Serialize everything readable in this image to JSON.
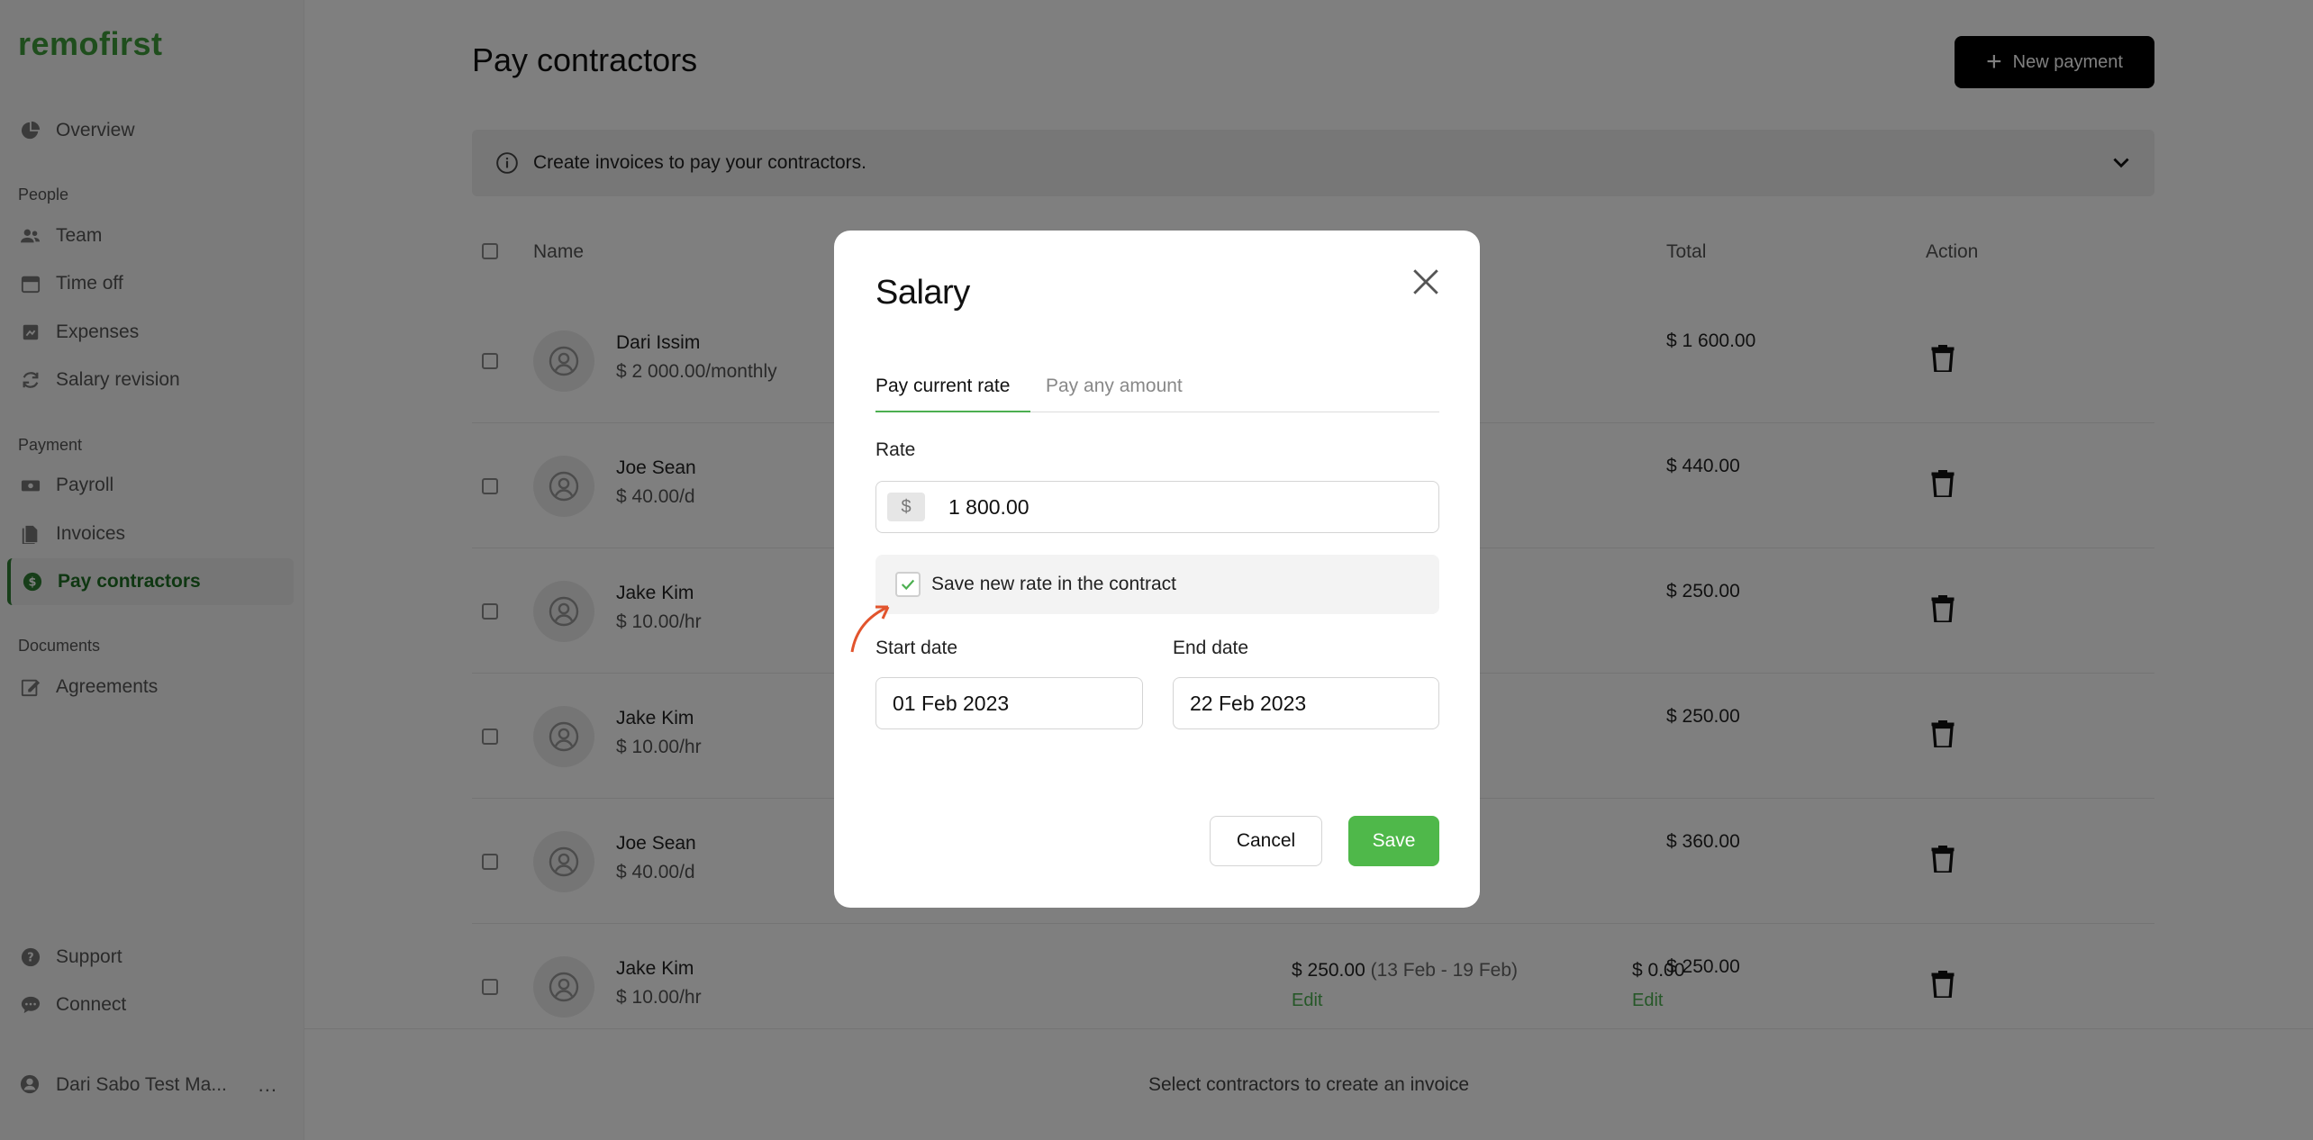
{
  "brand": {
    "logo": "remofirst",
    "accent": "#3e9c3a"
  },
  "sidebar": {
    "overview": "Overview",
    "sections": {
      "people": "People",
      "payment": "Payment",
      "documents": "Documents"
    },
    "people_items": [
      "Team",
      "Time off",
      "Expenses",
      "Salary revision"
    ],
    "payment_items": [
      "Payroll",
      "Invoices",
      "Pay contractors"
    ],
    "documents_items": [
      "Agreements"
    ],
    "bottom_items": [
      "Support",
      "Connect"
    ],
    "active_item": "Pay contractors",
    "user": {
      "name": "Dari Sabo Test Ma...",
      "more": "..."
    }
  },
  "header": {
    "title": "Pay contractors",
    "new_payment_label": "New payment"
  },
  "info": {
    "text": "Create invoices to pay your contractors."
  },
  "table": {
    "headers": {
      "name": "Name",
      "total": "Total",
      "action": "Action"
    },
    "rows": [
      {
        "name": "Dari Issim",
        "rate": "$ 2 000.00/monthly",
        "total": "$ 1 600.00"
      },
      {
        "name": "Joe Sean",
        "rate": "$ 40.00/d",
        "total": "$ 440.00"
      },
      {
        "name": "Jake Kim",
        "rate": "$ 10.00/hr",
        "total": "$ 250.00"
      },
      {
        "name": "Jake Kim",
        "rate": "$ 10.00/hr",
        "total": "$ 250.00"
      },
      {
        "name": "Joe Sean",
        "rate": "$ 40.00/d",
        "total": "$ 360.00"
      },
      {
        "name": "Jake Kim",
        "rate": "$ 10.00/hr",
        "total": "$ 250.00",
        "amount": "$ 250.00",
        "period": "(13 Feb - 19 Feb)",
        "extra": "$ 0.00",
        "edit": "Edit"
      }
    ]
  },
  "footer": {
    "text": "Select contractors to create an invoice"
  },
  "modal": {
    "title": "Salary",
    "tabs": [
      "Pay current rate",
      "Pay any amount"
    ],
    "active_tab": "Pay current rate",
    "rate_label": "Rate",
    "currency_prefix": "$",
    "rate_value": "1 800.00",
    "save_rate_label": "Save new rate in the contract",
    "save_rate_checked": true,
    "start_date_label": "Start date",
    "start_date_value": "01 Feb 2023",
    "end_date_label": "End date",
    "end_date_value": "22 Feb 2023",
    "cancel_label": "Cancel",
    "save_label": "Save",
    "save_color": "#4fb84a"
  }
}
